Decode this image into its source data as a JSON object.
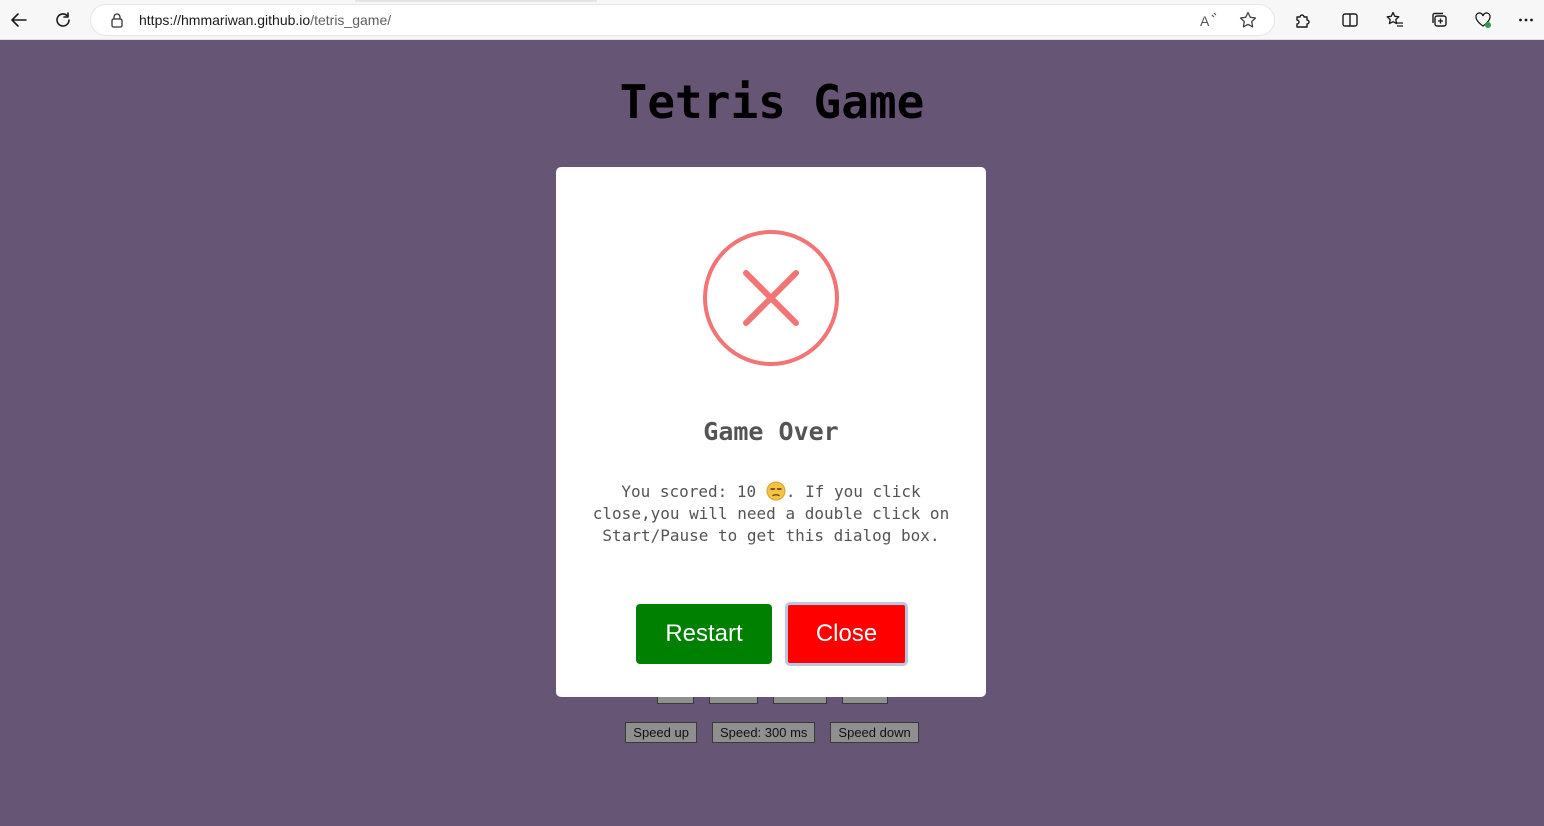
{
  "browser": {
    "url_host": "https://hmmariwan.github.io",
    "url_path": "/tetris_game/"
  },
  "page": {
    "title": "Tetris Game",
    "background": "#665574"
  },
  "controls": {
    "speed_up": "Speed up",
    "speed_value": "Speed: 300 ms",
    "speed_down": "Speed down"
  },
  "modal": {
    "title": "Game Over",
    "score_prefix": "You scored: 10",
    "message_rest": ". If you click close,you will need a double click on Start/Pause to get this dialog box.",
    "emoji": "unamused-face-emoji",
    "restart_label": "Restart",
    "close_label": "Close",
    "icon": "error-x-circle-icon",
    "icon_color": "#f27474",
    "restart_color": "#008000",
    "close_color": "#ff0000"
  }
}
